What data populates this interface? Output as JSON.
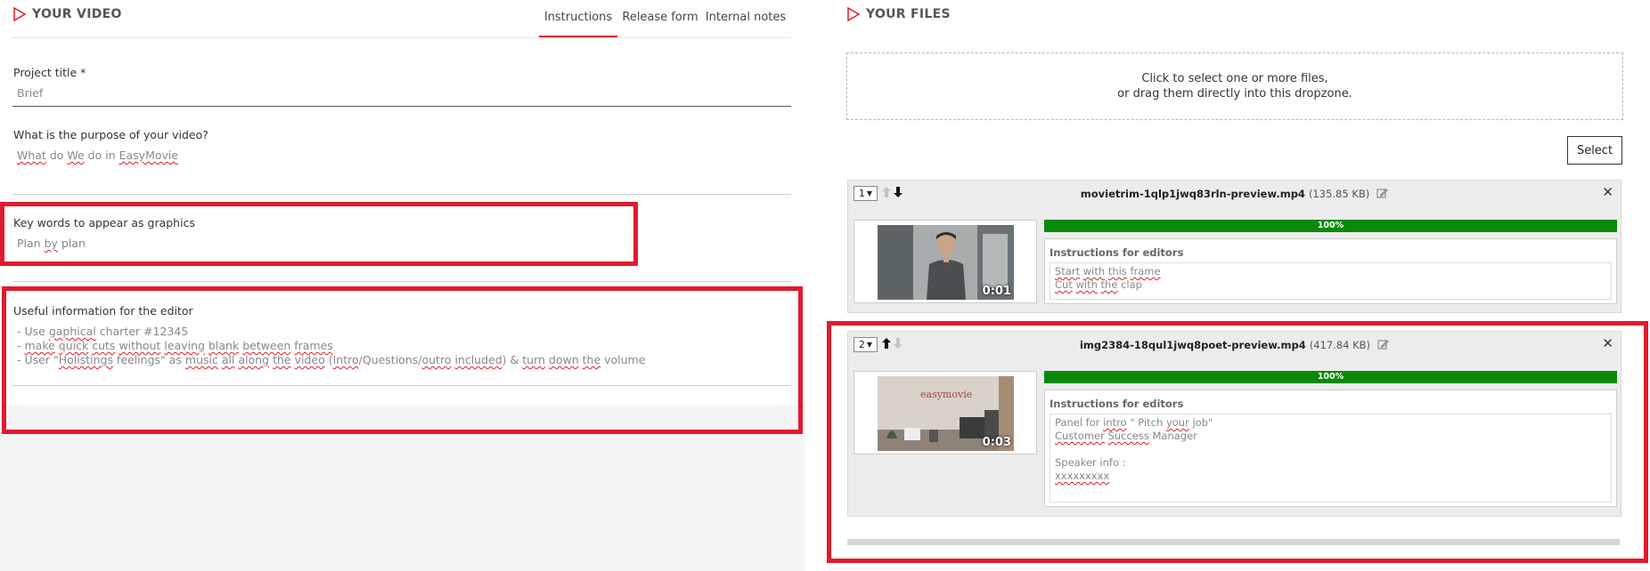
{
  "left": {
    "title": "YOUR VIDEO",
    "tabs": [
      {
        "label": "Instructions",
        "active": true
      },
      {
        "label": "Release form",
        "active": false
      },
      {
        "label": "Internal notes",
        "active": false
      }
    ],
    "project_title": {
      "label": "Project title *",
      "value": "Brief"
    },
    "purpose": {
      "label": "What is the purpose of your video?",
      "value": "What do We do in EasyMovie"
    },
    "keywords": {
      "label": "Key words to appear as graphics",
      "value": "Plan by plan"
    },
    "useful": {
      "label": "Useful information for the editor",
      "lines": [
        "- Use gaphical charter #12345",
        "- make quick cuts without leaving blank between frames",
        "- User \"Holistings feelings\" as music all along the video (Intro/Questions/outro included) & turn down the volume"
      ]
    }
  },
  "right": {
    "title": "YOUR FILES",
    "dropzone": {
      "line1": "Click to select one or more files,",
      "line2": "or drag them directly into this dropzone."
    },
    "select_label": "Select",
    "files": [
      {
        "order": "1",
        "name": "movietrim-1qlp1jwq83rln-preview.mp4",
        "size": "(135.85 KB)",
        "progress": "100%",
        "progress_value": 100,
        "duration": "0:01",
        "instructions_title": "Instructions for editors",
        "instructions": [
          "Start with this frame",
          "Cut with the clap"
        ]
      },
      {
        "order": "2",
        "name": "img2384-18qul1jwq8poet-preview.mp4",
        "size": "(417.84 KB)",
        "progress": "100%",
        "progress_value": 100,
        "duration": "0:03",
        "instructions_title": "Instructions for editors",
        "instructions": [
          "Panel for intro \" Pitch your job\"",
          "Customer Success Manager",
          "",
          "Speaker info :",
          "xxxxxxxxx"
        ]
      }
    ]
  },
  "colors": {
    "accent": "#e21a2d",
    "progress": "#0a8a0a"
  }
}
